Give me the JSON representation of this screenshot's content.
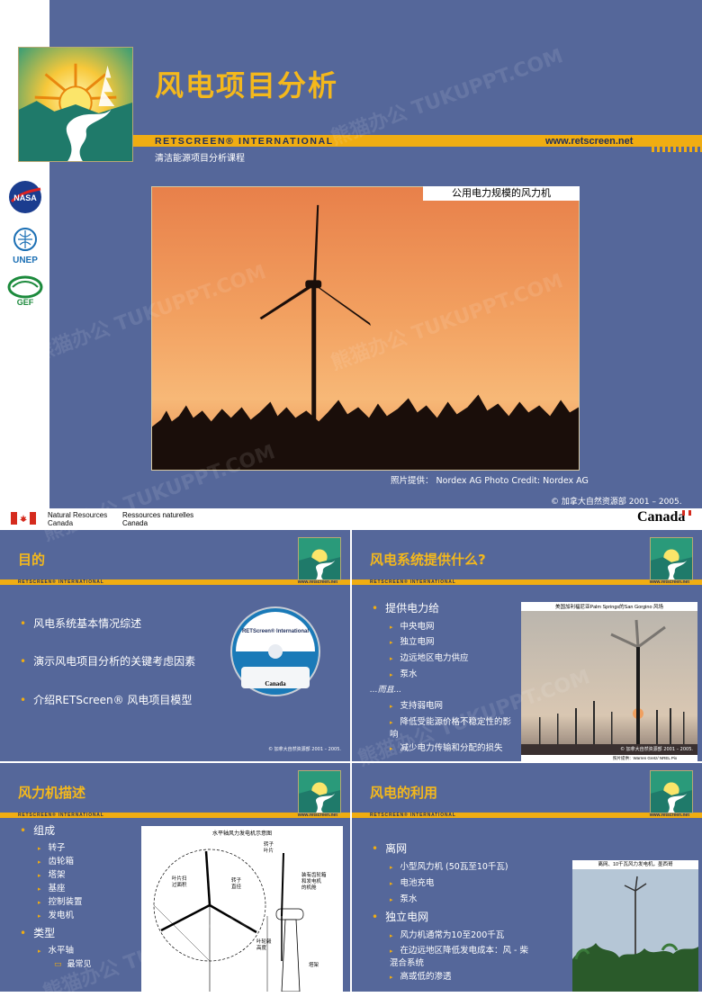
{
  "main": {
    "title": "风电项目分析",
    "brand": "RETSCREEN® INTERNATIONAL",
    "url": "www.retscreen.net",
    "subtitle": "清洁能源项目分析课程",
    "logos": {
      "nasa": "NASA",
      "unep": "UNEP",
      "gef": "GEF"
    },
    "photo_caption": "公用电力规模的风力机",
    "photo_credit": "照片提供： Nordex AG Photo Credit: Nordex AG",
    "copyright": "© 加拿大自然资源部 2001 – 2005."
  },
  "canada_bar": {
    "en_line1": "Natural Resources",
    "en_line2": "Canada",
    "fr_line1": "Ressources naturelles",
    "fr_line2": "Canada",
    "wordmark": "Canada"
  },
  "thumbs": {
    "common": {
      "brand": "RETSCREEN® INTERNATIONAL",
      "url": "www.retscreen.net",
      "copy": "© 加拿大自然资源部 2001 – 2005."
    },
    "objectives": {
      "title": "目的",
      "bullets": [
        "风电系统基本情况综述",
        "演示风电项目分析的关键考虑因素",
        "介绍RETScreen® 风电项目模型"
      ],
      "cd_label": "RETScreen® International",
      "cd_wordmark": "Canada"
    },
    "what": {
      "title": "风电系统提供什么?",
      "b1": "提供电力给",
      "subs1": [
        "中央电网",
        "独立电网",
        "边远地区电力供应",
        "泵水"
      ],
      "mid": "...而且...",
      "subs2": [
        "支持弱电网",
        "降低受能源价格不稳定性的影响",
        "减少电力传输和分配的损失"
      ],
      "photo_caption": "美国加利福尼亚Palm Springs的San Gorgino 风场",
      "photo_credit": "照片提供：Warren Gretz/ NREL Pix"
    },
    "desc": {
      "title": "风力机描述",
      "b1": "组成",
      "subs1": [
        "转子",
        "齿轮箱",
        "塔架",
        "基座",
        "控制装置",
        "发电机"
      ],
      "b2": "类型",
      "sub2": "水平轴",
      "sub3": "最常见",
      "diagram_title": "水平轴风力发电机示意图",
      "labels": [
        "转子\n叶片",
        "叶片扫\n过面积",
        "转子\n直径",
        "装有齿轮箱\n和发电机\n的机舱",
        "转子\n叶片",
        "叶轮毂\n高度",
        "塔架"
      ]
    },
    "use": {
      "title": "风电的利用",
      "b1": "离网",
      "subs1": [
        "小型风力机 (50瓦至10千瓦)",
        "电池充电",
        "泵水"
      ],
      "b2": "独立电网",
      "subs2": [
        "风力机通常为10至200千瓦",
        "在边远地区降低发电成本：风 - 柴混合系统",
        "高或低的渗透"
      ],
      "photo_caption": "离网、10千瓦风力发电机，墨西哥"
    }
  },
  "watermark": "熊猫办公 TUKUPPT.COM",
  "colors": {
    "slide_bg": "#55679a",
    "accent": "#f0ad12",
    "title": "#f4b81c"
  }
}
